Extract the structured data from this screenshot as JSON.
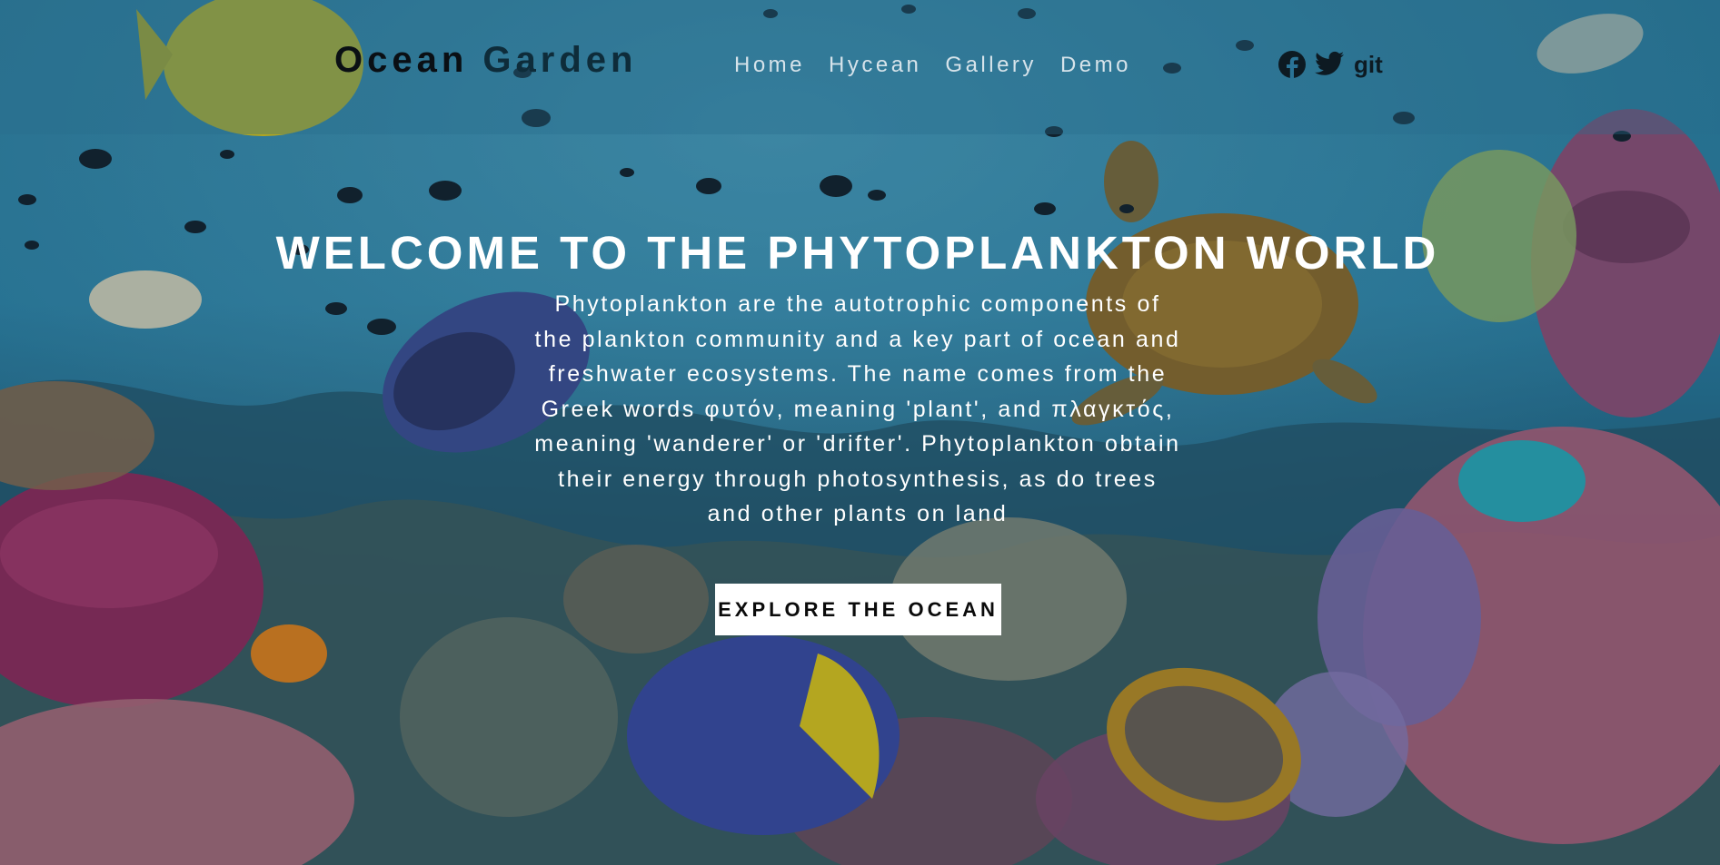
{
  "header": {
    "brand_word1": "Ocean",
    "brand_word2": "Garden",
    "nav": [
      "Home",
      "Hycean",
      "Gallery",
      "Demo"
    ],
    "social": {
      "facebook_icon": "facebook-icon",
      "twitter_icon": "twitter-icon",
      "git_label": "git"
    }
  },
  "hero": {
    "title": "WELCOME TO THE PHYTOPLANKTON WORLD",
    "description": "Phytoplankton are the autotrophic components of the plankton community and a key part of ocean and freshwater ecosystems. The name comes from the Greek words φυτόν, meaning 'plant', and πλαγκτός, meaning 'wanderer' or 'drifter'. Phytoplankton obtain their energy through photosynthesis, as do trees and other plants on land",
    "button": "EXPLORE THE OCEAN"
  },
  "colors": {
    "water": "#2a7fa0",
    "nav_text": "#d6e3ea",
    "button_bg": "#ffffff"
  }
}
